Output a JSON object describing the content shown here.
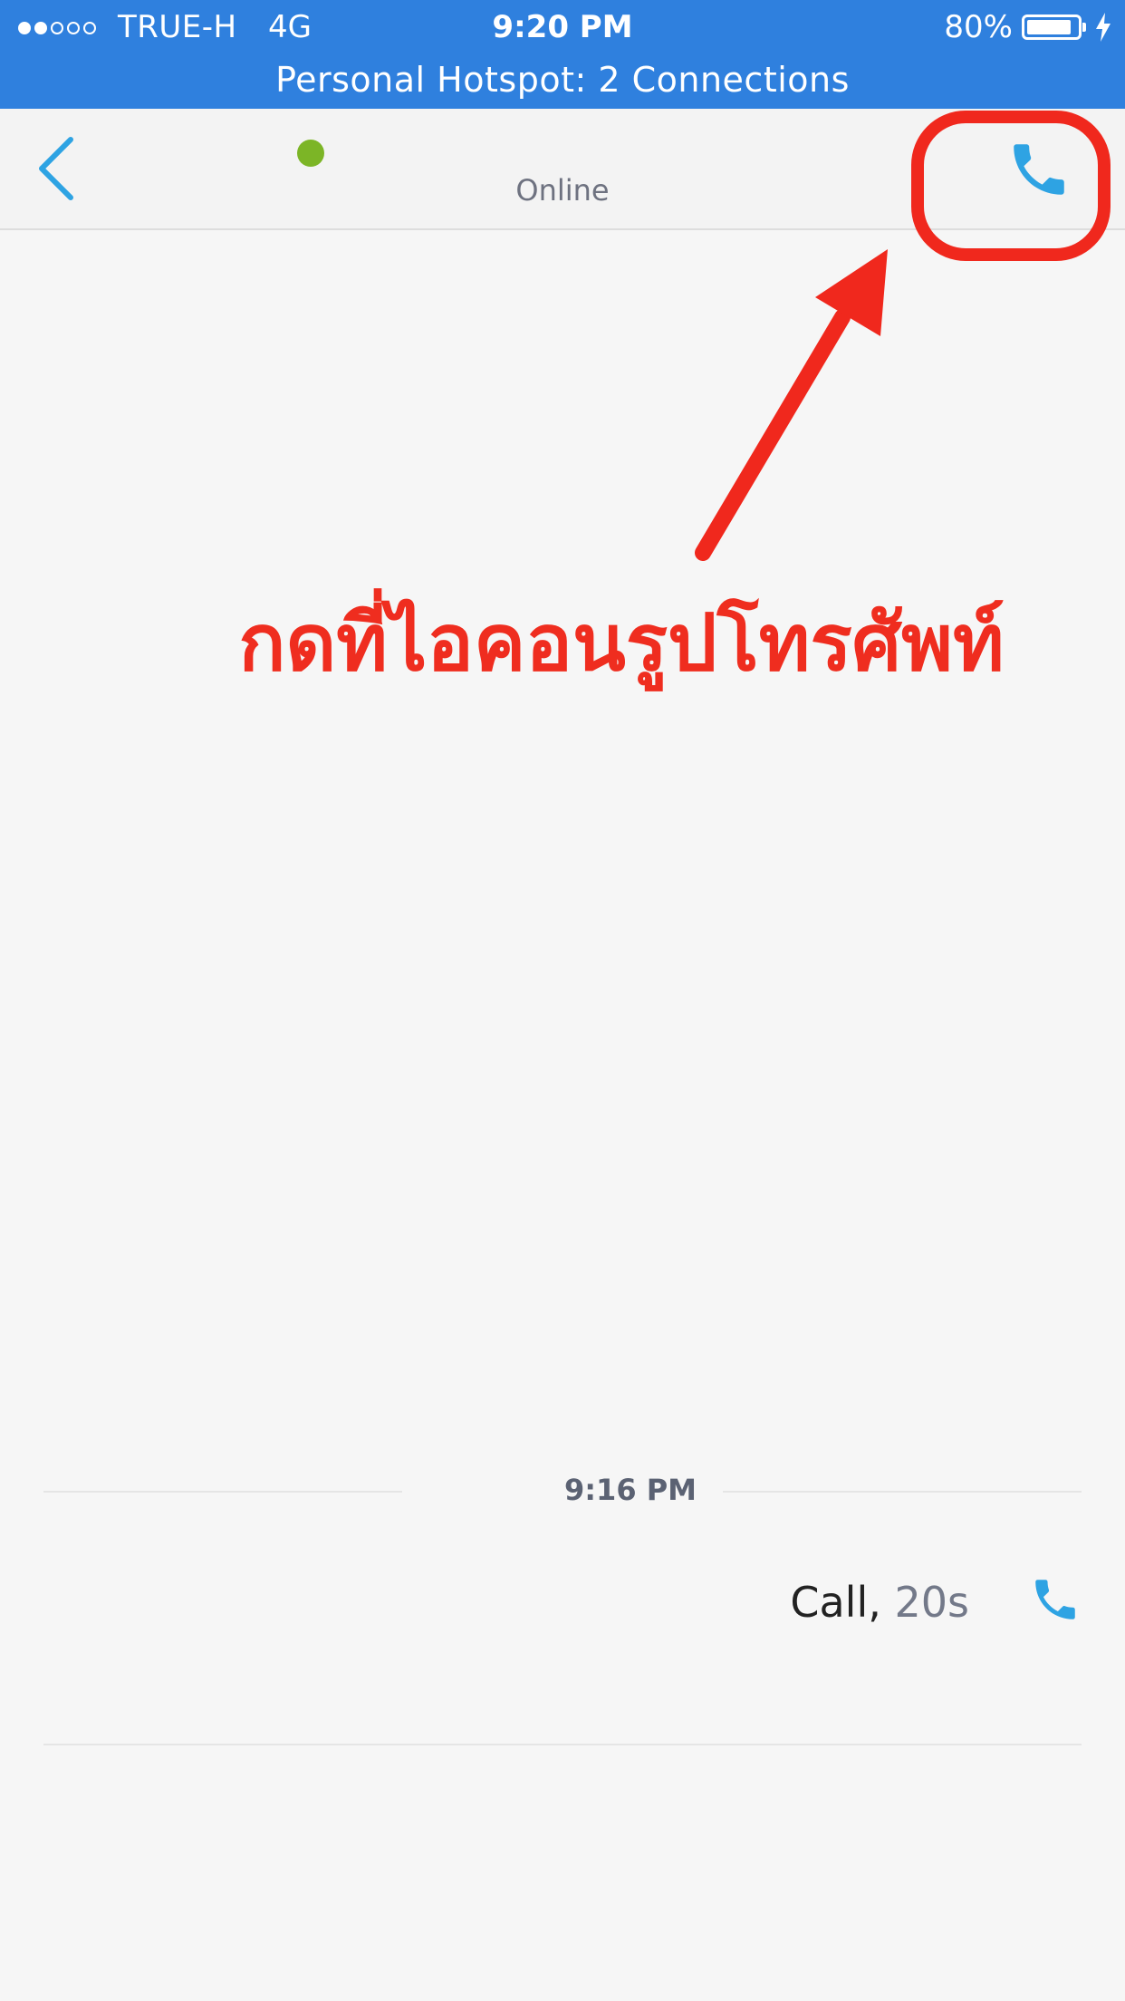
{
  "status_bar": {
    "carrier": "TRUE-H",
    "network": "4G",
    "time": "9:20 PM",
    "battery_percent": "80%",
    "signal_bars_filled": 2,
    "signal_bars_total": 5,
    "battery_level": 0.8,
    "charging": true
  },
  "hotspot_banner": {
    "text": "Personal Hotspot: 2 Connections"
  },
  "header": {
    "presence_status": "Online",
    "back_icon": "chevron-left-icon",
    "call_icon": "phone-icon"
  },
  "annotation": {
    "text": "กดที่ไอคอนรูปโทรศัพท์",
    "color": "#ef2d1f"
  },
  "conversation": {
    "divider_time": "9:16 PM",
    "call_entry": {
      "label": "Call,",
      "duration": "20s",
      "icon": "phone-icon"
    }
  },
  "colors": {
    "status_bar_bg": "#2f80de",
    "accent_blue": "#2ea3e3",
    "online_green": "#7cb526",
    "annotation_red": "#f0281d"
  }
}
